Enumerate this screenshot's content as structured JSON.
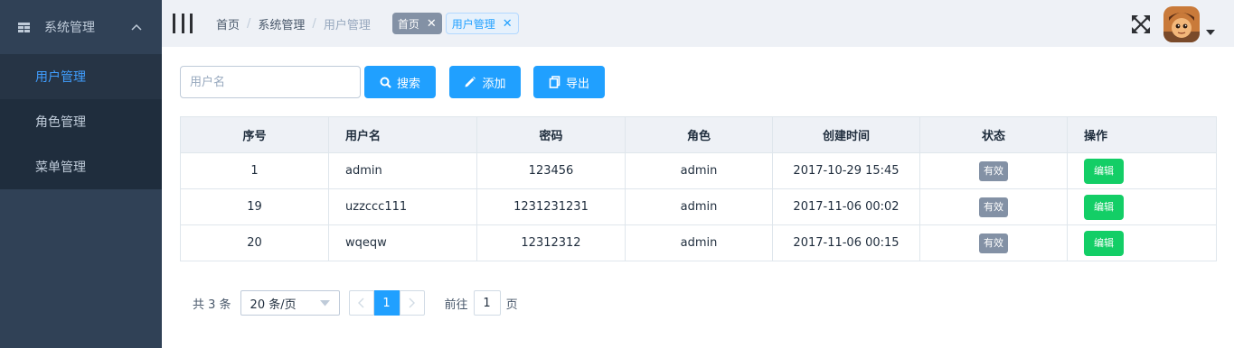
{
  "sidebar": {
    "menu_title": "系统管理",
    "items": [
      {
        "label": "用户管理",
        "active": true
      },
      {
        "label": "角色管理",
        "active": false
      },
      {
        "label": "菜单管理",
        "active": false
      }
    ]
  },
  "topbar": {
    "breadcrumb": [
      "首页",
      "系统管理",
      "用户管理"
    ],
    "tags": [
      {
        "label": "首页",
        "close": "✕"
      },
      {
        "label": "用户管理",
        "close": "✕"
      }
    ]
  },
  "filters": {
    "username_placeholder": "用户名",
    "search_label": "搜索",
    "add_label": "添加",
    "export_label": "导出"
  },
  "table": {
    "headers": [
      "序号",
      "用户名",
      "密码",
      "角色",
      "创建时间",
      "状态",
      "操作"
    ],
    "rows": [
      {
        "id": "1",
        "username": "admin",
        "password": "123456",
        "role": "admin",
        "created": "2017-10-29 15:45",
        "status": "有效",
        "action": "编辑"
      },
      {
        "id": "19",
        "username": "uzzccc111",
        "password": "1231231231",
        "role": "admin",
        "created": "2017-11-06 00:02",
        "status": "有效",
        "action": "编辑"
      },
      {
        "id": "20",
        "username": "wqeqw",
        "password": "12312312",
        "role": "admin",
        "created": "2017-11-06 00:15",
        "status": "有效",
        "action": "编辑"
      }
    ]
  },
  "pagination": {
    "total_text": "共 3 条",
    "page_size": "20 条/页",
    "current_page": "1",
    "goto_prefix": "前往",
    "goto_value": "1",
    "goto_suffix": "页"
  },
  "colors": {
    "sidebar_bg": "#304156",
    "submenu_bg": "#1f2d3d",
    "accent": "#20a0ff",
    "success": "#13ce66",
    "tag_gray": "#8391a5"
  },
  "icons": {
    "menu": "grid-icon",
    "collapse": "chevron-up-icon",
    "hamburger": "hamburger-icon",
    "fullscreen": "fullscreen-icon",
    "search": "search-icon",
    "add": "pencil-icon",
    "export": "copy-icon"
  }
}
